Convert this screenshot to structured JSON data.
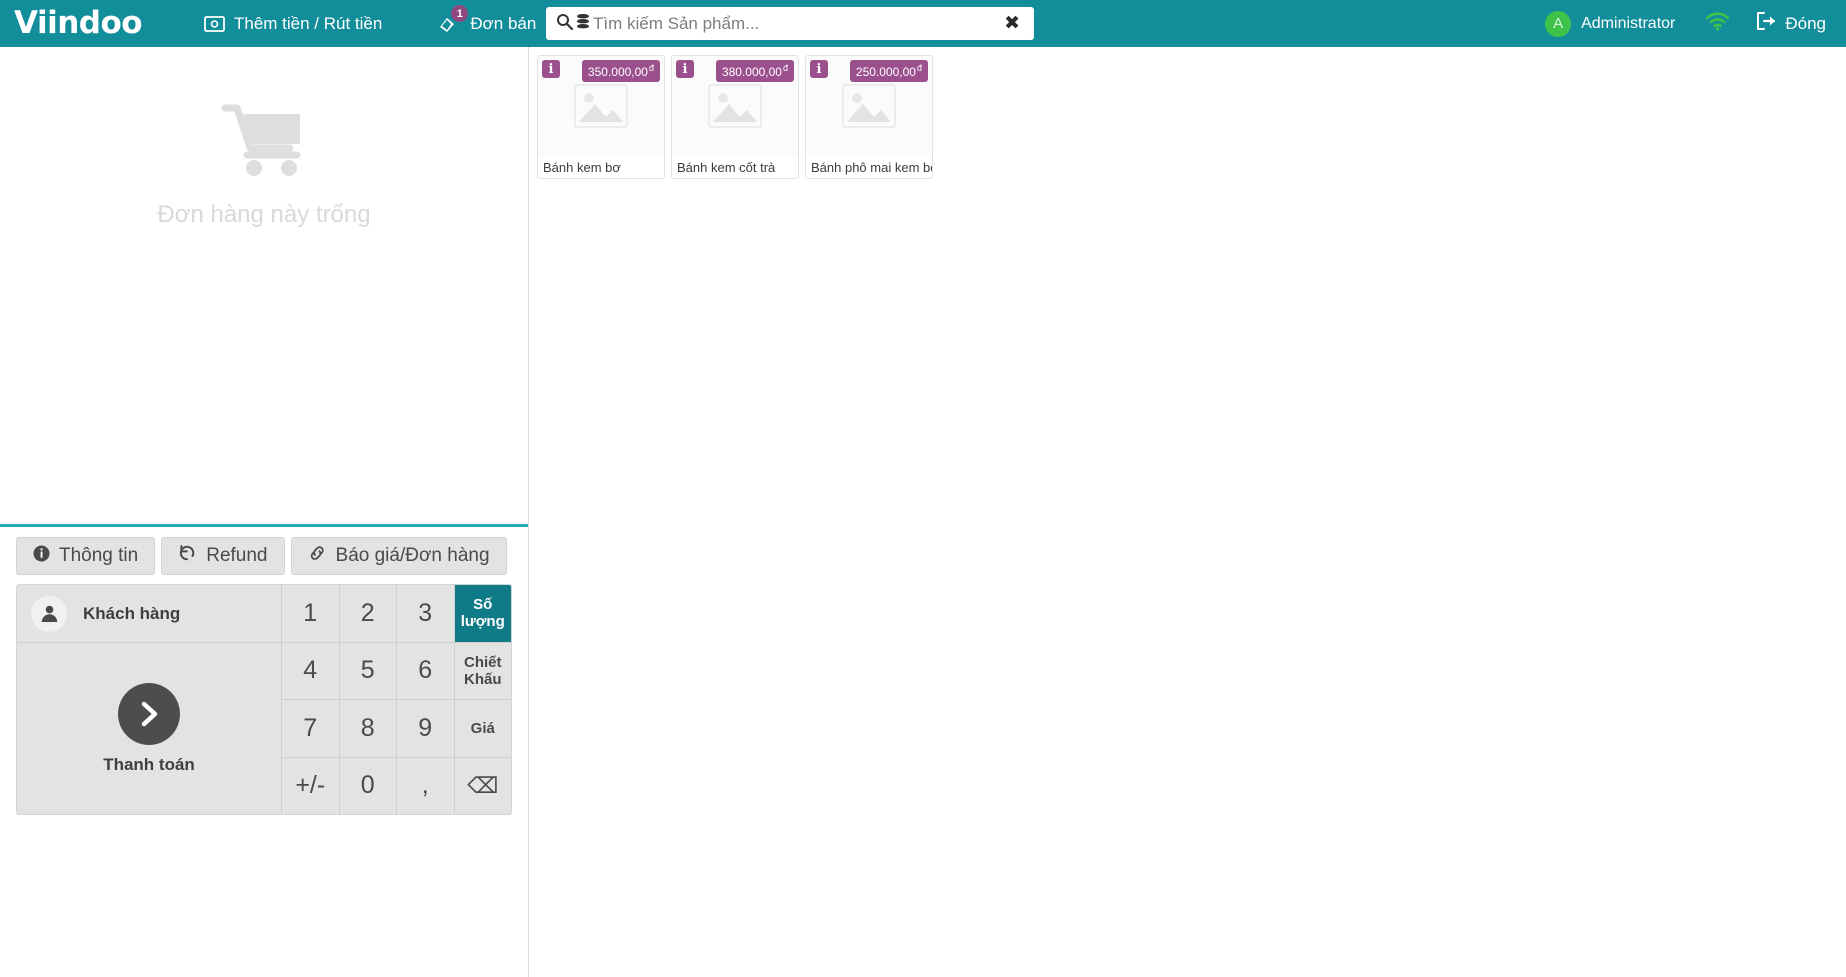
{
  "header": {
    "logo": "Viindoo",
    "cash_button": "Thêm tiền / Rút tiền",
    "orders_button": "Đơn bán",
    "orders_badge": "1",
    "user_initial": "A",
    "user_name": "Administrator",
    "close_button": "Đóng"
  },
  "search": {
    "placeholder": "Tìm kiếm Sản phẩm...",
    "value": "",
    "clear_glyph": "✖"
  },
  "order": {
    "empty_text": "Đơn hàng này trống"
  },
  "actions": [
    {
      "label": "Thông tin",
      "icon": "info-icon"
    },
    {
      "label": "Refund",
      "icon": "refund-icon"
    },
    {
      "label": "Báo giá/Đơn hàng",
      "icon": "link-icon"
    }
  ],
  "customer": {
    "label": "Khách hàng",
    "pay_label": "Thanh toán"
  },
  "numpad": {
    "keys": [
      "1",
      "2",
      "3",
      "4",
      "5",
      "6",
      "7",
      "8",
      "9",
      "+/-",
      "0",
      ","
    ],
    "backspace_glyph": "⌫",
    "modes": [
      {
        "label": "Số lượng",
        "active": true
      },
      {
        "label": "Chiết Khấu",
        "active": false
      },
      {
        "label": "Giá",
        "active": false
      }
    ]
  },
  "products": [
    {
      "name": "Bánh kem bơ",
      "price": "350.000,00",
      "currency": "đ"
    },
    {
      "name": "Bánh kem cốt trà",
      "price": "380.000,00",
      "currency": "đ"
    },
    {
      "name": "Bánh phô mai kem bơ",
      "price": "250.000,00",
      "currency": "đ"
    }
  ],
  "colors": {
    "brand_teal": "#128d9a",
    "accent_purple": "#9b4f8c",
    "active_teal": "#0f7b86",
    "avatar_green": "#3ec24a"
  }
}
